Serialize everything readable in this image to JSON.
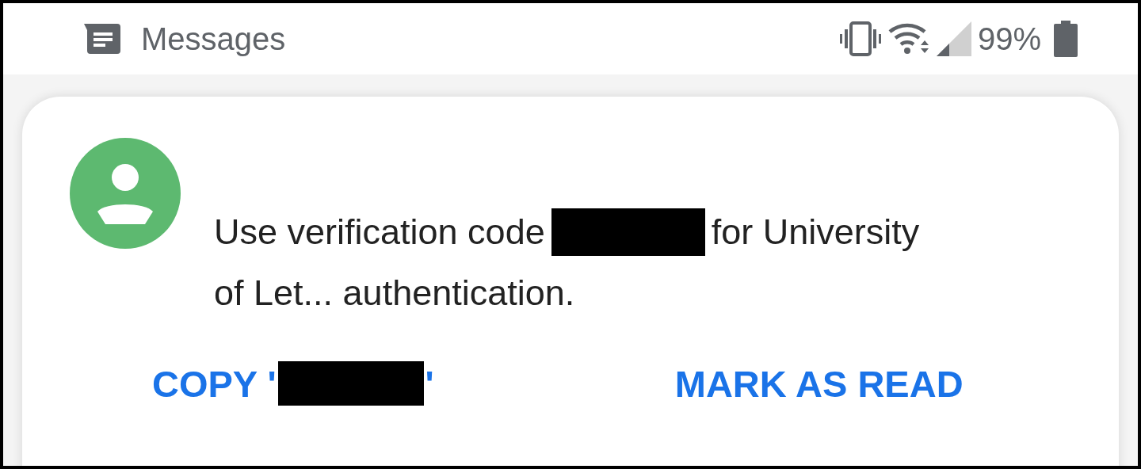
{
  "status_bar": {
    "app_name": "Messages",
    "battery": "99%"
  },
  "notification": {
    "lead": "Use verification code",
    "trail": "for University",
    "continuation": "of Let... authentication.",
    "actions": [
      {
        "kind": "copy",
        "before": "COPY '",
        "after": "'"
      },
      {
        "kind": "plain",
        "label": "MARK AS READ"
      }
    ]
  }
}
